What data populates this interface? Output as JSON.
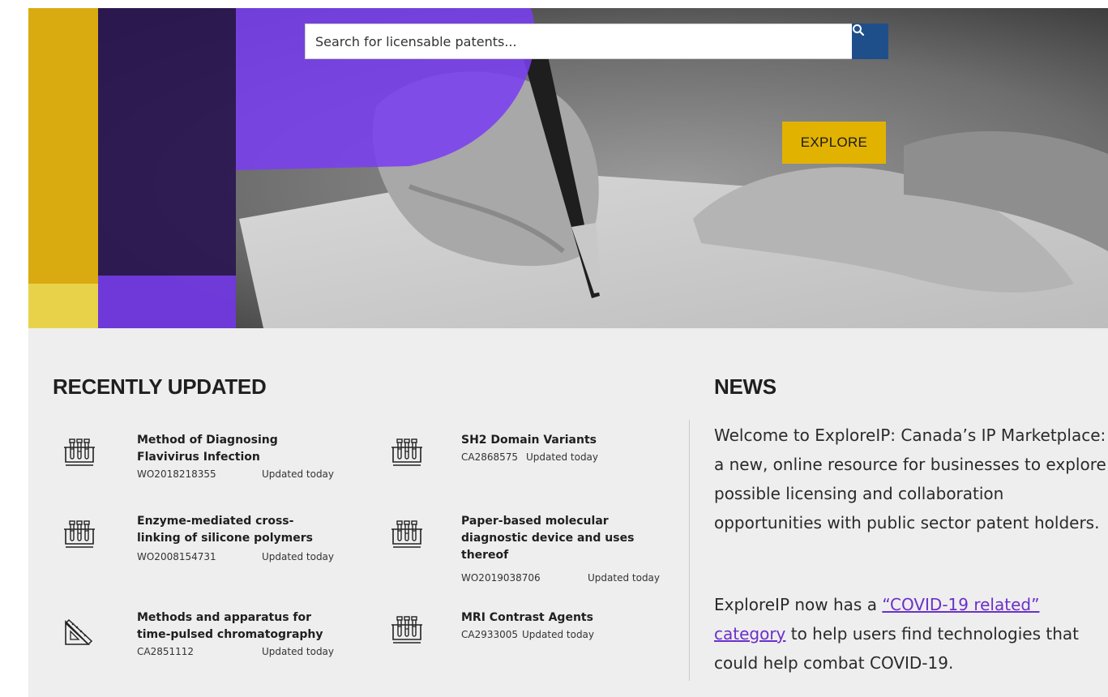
{
  "hero": {
    "search": {
      "placeholder": "Search for licensable patents..."
    },
    "search_button_icon": "search-icon",
    "explore_label": "EXPLORE"
  },
  "recently_updated": {
    "heading": "RECENTLY UPDATED",
    "items": [
      {
        "title": "Method of Diagnosing Flavivirus Infection",
        "id": "WO2018218355",
        "updated": "Updated today",
        "icon": "test-tubes-icon"
      },
      {
        "title": "Enzyme-mediated cross-linking of silicone polymers",
        "id": "WO2008154731",
        "updated": "Updated today",
        "icon": "test-tubes-icon"
      },
      {
        "title": "Methods and apparatus for time-pulsed chromatography",
        "id": "CA2851112",
        "updated": "Updated today",
        "icon": "drafting-tools-icon"
      },
      {
        "title": "SH2 Domain Variants",
        "id": "CA2868575",
        "updated": "Updated today",
        "icon": "test-tubes-icon"
      },
      {
        "title": "Paper-based molecular diagnostic device and uses thereof",
        "id": "WO2019038706",
        "updated": "Updated today",
        "icon": "test-tubes-icon"
      },
      {
        "title": "MRI Contrast Agents",
        "id": "CA2933005",
        "updated": "Updated today",
        "icon": "test-tubes-icon"
      }
    ]
  },
  "news": {
    "heading": "NEWS",
    "paragraph1": "Welcome to ExploreIP: Canada’s IP Marketplace: a new, online resource for businesses to explore possible licensing and collaboration opportunities with public sector patent holders.",
    "paragraph2_before": "ExploreIP now has a ",
    "paragraph2_link": "“COVID-19 related” category",
    "paragraph2_after": " to help users find technologies that could help combat COVID-19."
  },
  "colors": {
    "accent_yellow": "#e2b200",
    "accent_purple": "#7a3ff0",
    "search_blue": "#1f4f8a",
    "link_purple": "#6b2fc9"
  }
}
